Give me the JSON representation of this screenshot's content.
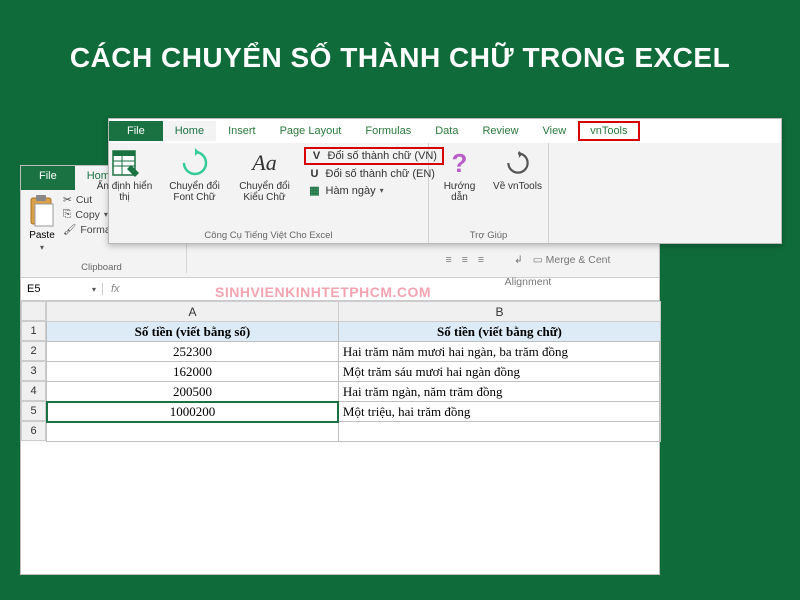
{
  "banner": "CÁCH CHUYỂN SỐ THÀNH CHỮ TRONG EXCEL",
  "watermark": "SINHVIENKINHTETPHCM.COM",
  "fg": {
    "tabs": [
      "File",
      "Home",
      "Insert",
      "Page Layout",
      "Formulas",
      "Data",
      "Review",
      "View",
      "vnTools"
    ],
    "active_tab": "Home",
    "highlight_tab": "vnTools",
    "group1": {
      "label": "Công Cụ Tiếng Việt Cho Excel",
      "item1": "Ẩn định hiển thị",
      "item2": "Chuyển đổi Font Chữ",
      "item3": "Chuyển đổi Kiểu Chữ",
      "vn": "Đổi số thành chữ (VN)",
      "en": "Đổi số thành chữ (EN)",
      "hn": "Hàm ngày"
    },
    "group2": {
      "label": "Trợ Giúp",
      "help": "Hướng dẫn",
      "about": "Về vnTools"
    }
  },
  "bg": {
    "tabs": [
      "File",
      "Home"
    ],
    "clipboard": {
      "paste": "Paste",
      "cut": "Cut",
      "copy": "Copy",
      "fp": "Format Painter",
      "label": "Clipboard"
    },
    "align_label": "Alignment",
    "merge": "Merge & Cent",
    "namebox": "E5",
    "fx": "fx"
  },
  "sheet": {
    "cols": [
      "A",
      "B"
    ],
    "header": {
      "a": "Số tiền (viết bằng số)",
      "b": "Số tiền (viết bằng chữ)"
    },
    "rows": [
      {
        "num": "252300",
        "text": "Hai trăm năm mươi hai ngàn, ba trăm đồng"
      },
      {
        "num": "162000",
        "text": "Một trăm sáu mươi hai ngàn đồng"
      },
      {
        "num": "200500",
        "text": "Hai trăm ngàn, năm trăm đồng"
      },
      {
        "num": "1000200",
        "text": "Một triệu, hai trăm đồng"
      }
    ]
  }
}
